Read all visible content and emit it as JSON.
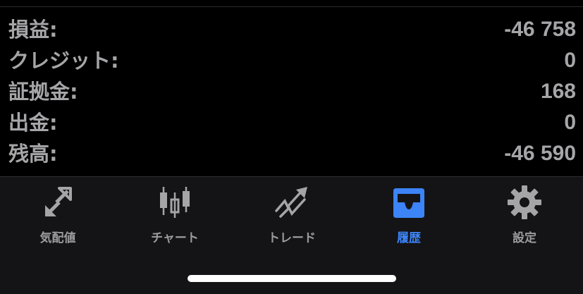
{
  "summary": {
    "rows": [
      {
        "label": "損益:",
        "value": "-46 758"
      },
      {
        "label": "クレジット:",
        "value": "0"
      },
      {
        "label": "証拠金:",
        "value": "168"
      },
      {
        "label": "出金:",
        "value": "0"
      },
      {
        "label": "残高:",
        "value": "-46 590"
      }
    ]
  },
  "tabbar": {
    "active_color": "#3c84f7",
    "inactive_color": "#9c9c9f",
    "tabs": [
      {
        "label": "気配値",
        "icon": "arrows-diagonal-icon",
        "active": false
      },
      {
        "label": "チャート",
        "icon": "candlestick-chart-icon",
        "active": false
      },
      {
        "label": "トレード",
        "icon": "trend-arrow-icon",
        "active": false
      },
      {
        "label": "履歴",
        "icon": "inbox-tray-icon",
        "active": true
      },
      {
        "label": "設定",
        "icon": "gear-icon",
        "active": false
      }
    ]
  }
}
